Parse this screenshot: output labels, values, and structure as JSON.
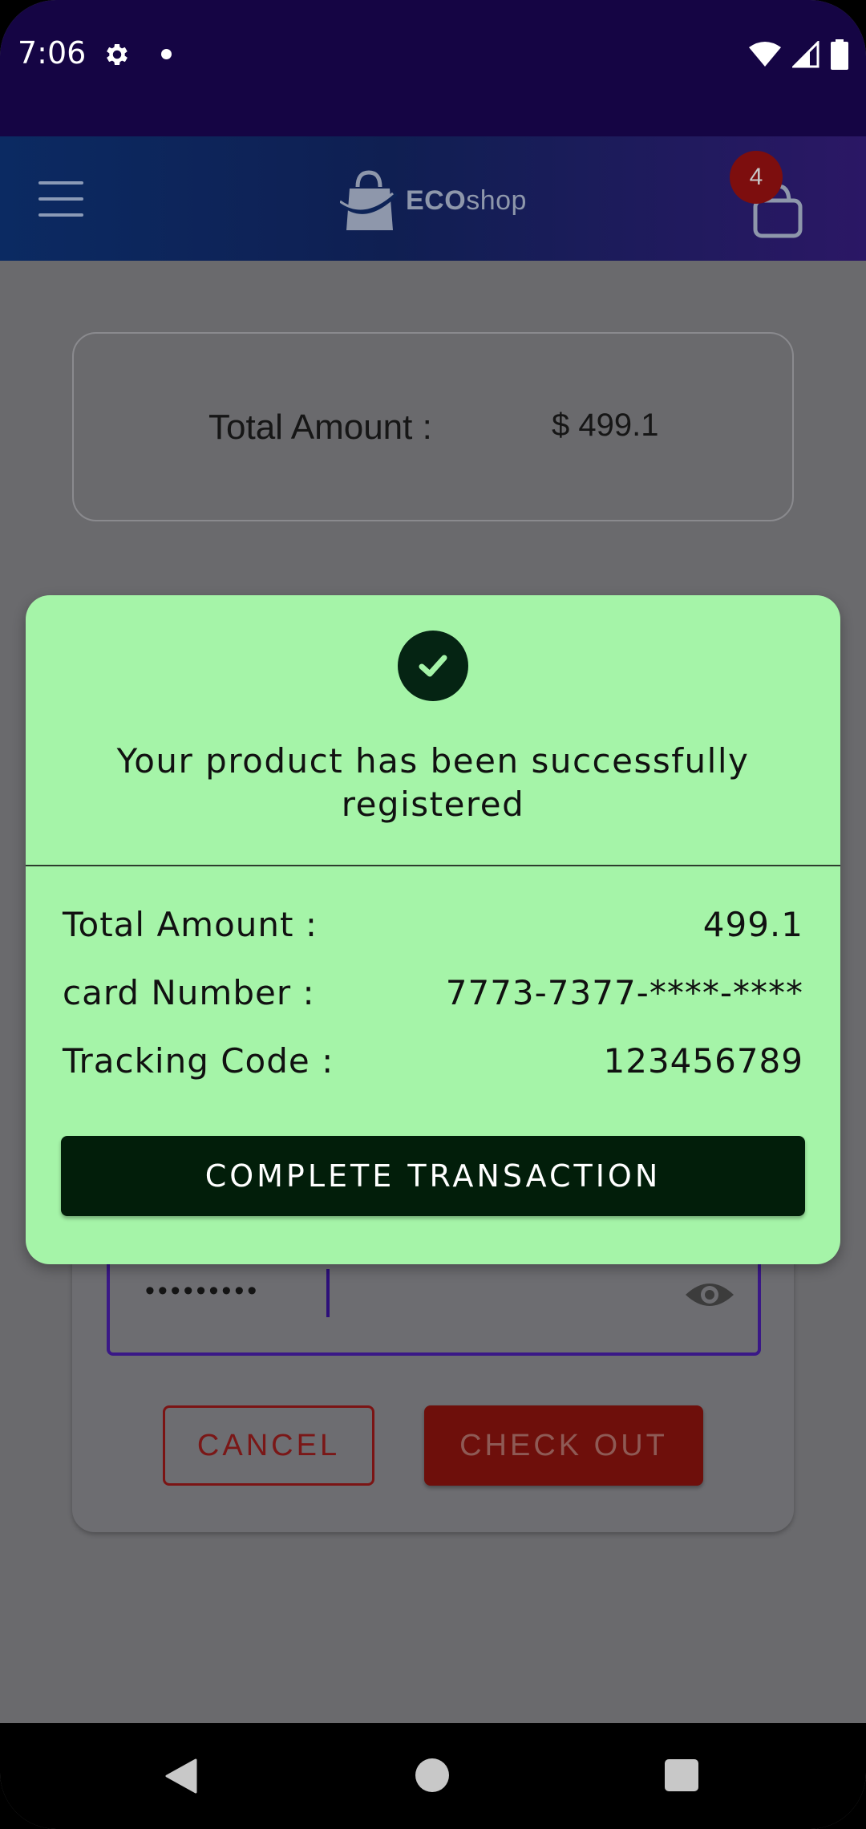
{
  "status_bar": {
    "time": "7:06",
    "icons": [
      "gear-icon",
      "dot-icon",
      "wifi-icon",
      "signal-icon",
      "battery-icon"
    ]
  },
  "app_bar": {
    "logo_bold": "ECO",
    "logo_light": "shop",
    "cart_count": "4",
    "icons": [
      "menu-icon",
      "shopping-bag-logo-icon",
      "cart-icon"
    ]
  },
  "background": {
    "total_label": "Total Amount :",
    "total_value": "$ 499.1",
    "password_dots": "•••••••••",
    "cancel_label": "CANCEL",
    "checkout_label": "CHECK OUT"
  },
  "dialog": {
    "message": "Your product has been successfully registered",
    "rows": [
      {
        "label": "Total Amount :",
        "value": "499.1"
      },
      {
        "label": "card Number :",
        "value": "7773-7377-****-****"
      },
      {
        "label": "Tracking Code :",
        "value": "123456789"
      }
    ],
    "button_label": "COMPLETE TRANSACTION"
  },
  "colors": {
    "status_bar": "#150544",
    "dialog_bg": "#a5f4a8",
    "primary_dark": "#021e0a",
    "danger": "#6e0f0b"
  }
}
